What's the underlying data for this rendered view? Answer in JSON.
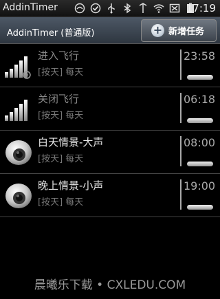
{
  "status_bar": {
    "app_name": "AddinTimer",
    "time": "17:19",
    "icons": [
      "messaging-icon",
      "check-icon",
      "usb-icon",
      "bluetooth-icon",
      "transfer-icon",
      "wifi-icon",
      "no-signal-icon",
      "battery-icon"
    ]
  },
  "header": {
    "title": "AddinTimer (普通版)",
    "add_button_label": "新增任务"
  },
  "tasks": [
    {
      "name": "进入飞行",
      "rule": "[按天] 每天",
      "time": "23:58",
      "icon": "signal-bars-icon",
      "enabled": false
    },
    {
      "name": "关闭飞行",
      "rule": "[按天] 每天",
      "time": "06:18",
      "icon": "signal-bars-icon",
      "enabled": false
    },
    {
      "name": "白天情景-大声",
      "rule": "[按天] 每天",
      "time": "08:00",
      "icon": "speaker-icon",
      "enabled": true
    },
    {
      "name": "晚上情景-小声",
      "rule": "[按天] 每天",
      "time": "19:00",
      "icon": "speaker-icon",
      "enabled": true
    }
  ],
  "watermark": "晨曦乐下载 • CXLEDU.COM"
}
